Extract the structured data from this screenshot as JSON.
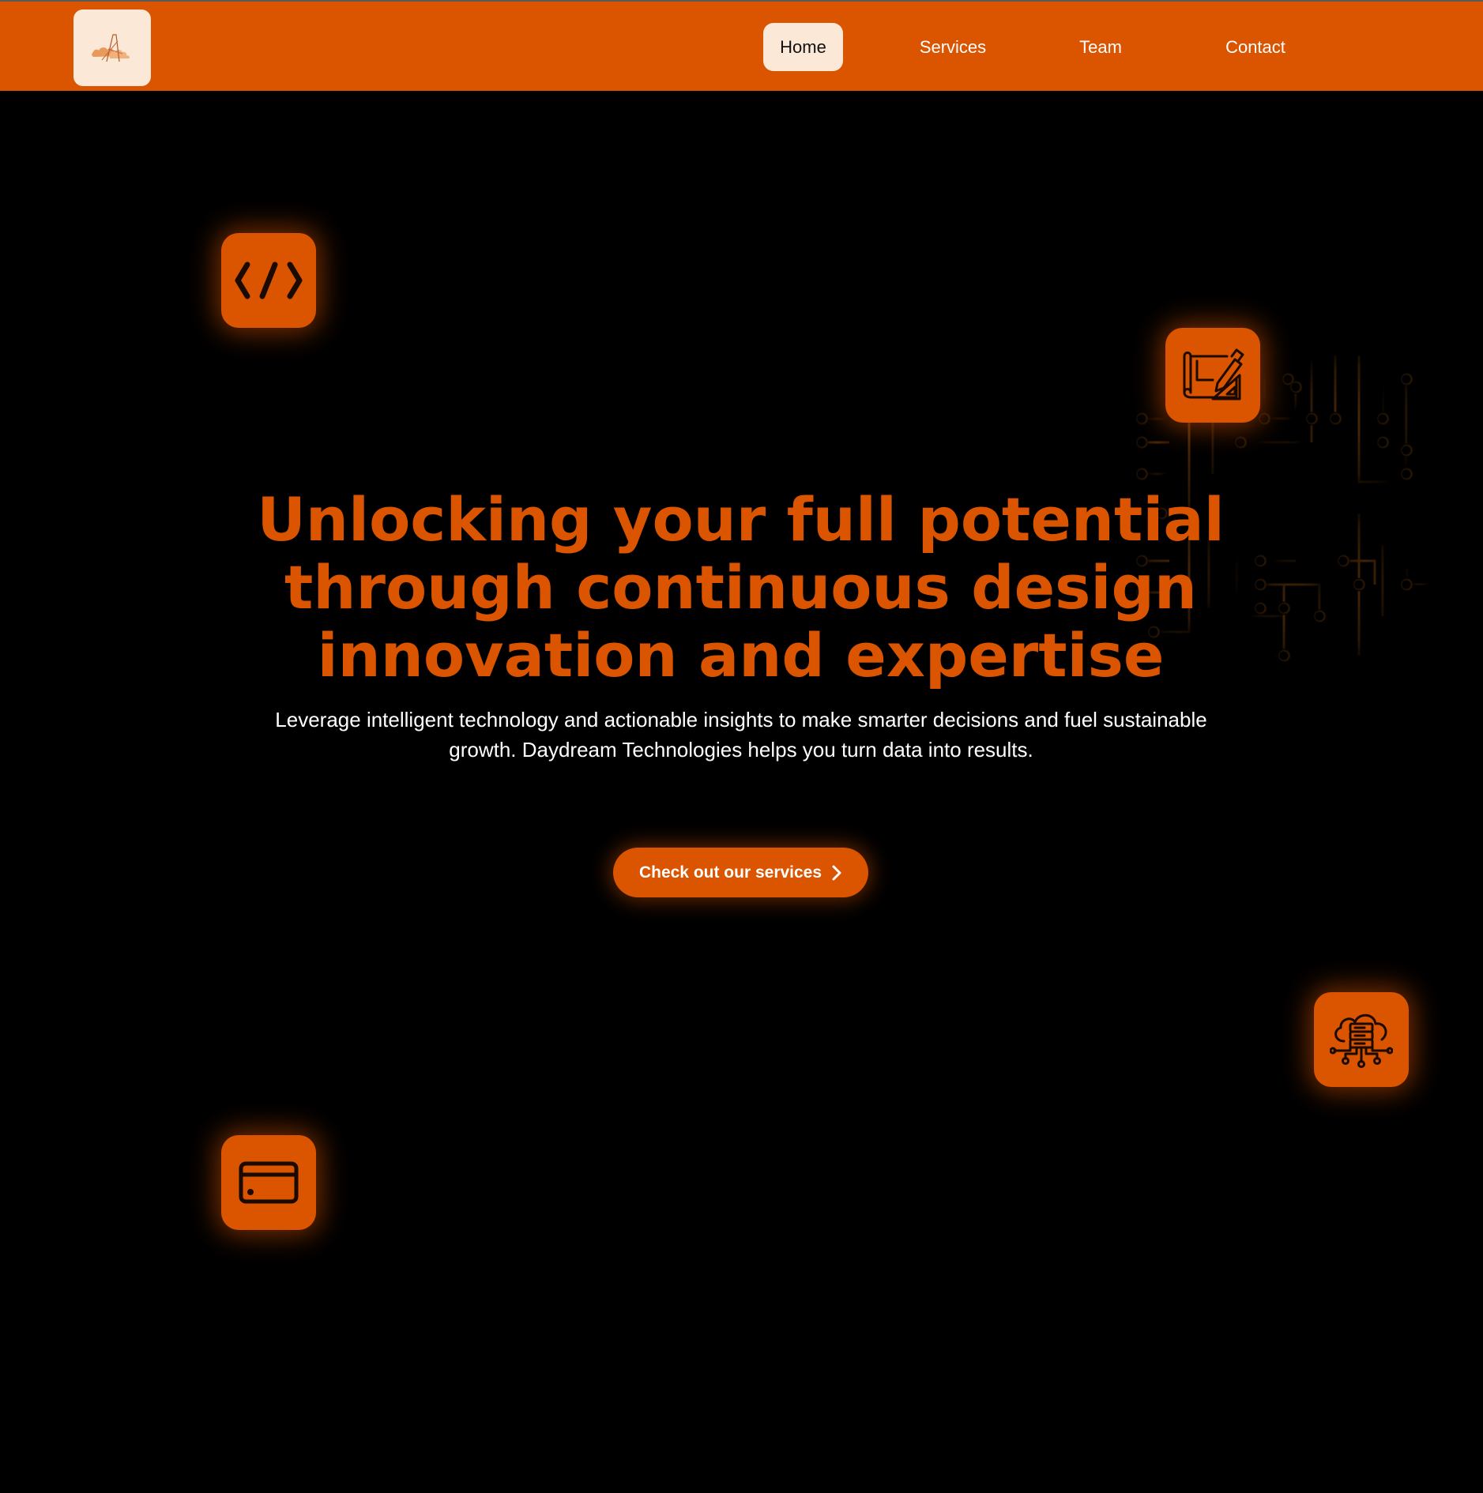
{
  "header": {
    "logo_icon": "cloud-logo-icon",
    "nav": [
      {
        "label": "Home",
        "active": true
      },
      {
        "label": "Services",
        "active": false
      },
      {
        "label": "Team",
        "active": false
      },
      {
        "label": "Contact",
        "active": false
      }
    ]
  },
  "hero": {
    "title_lines": [
      "Unlocking your full potential",
      "through continuous design",
      "innovation and expertise"
    ],
    "subtitle_lines": [
      "Leverage intelligent technology and actionable insights to make smarter decisions and fuel sustainable",
      "growth. Daydream Technologies helps you turn data into results."
    ],
    "cta_label": "Check out our services",
    "cta_icon": "chevron-right-icon"
  },
  "floating_icons": [
    "code-icon",
    "blueprint-design-icon",
    "cloud-server-network-icon",
    "credit-card-icon"
  ],
  "colors": {
    "accent": "#db5400",
    "background": "#000000",
    "nav_active_bg": "#fbe8d7",
    "text_light": "#ffffff"
  }
}
